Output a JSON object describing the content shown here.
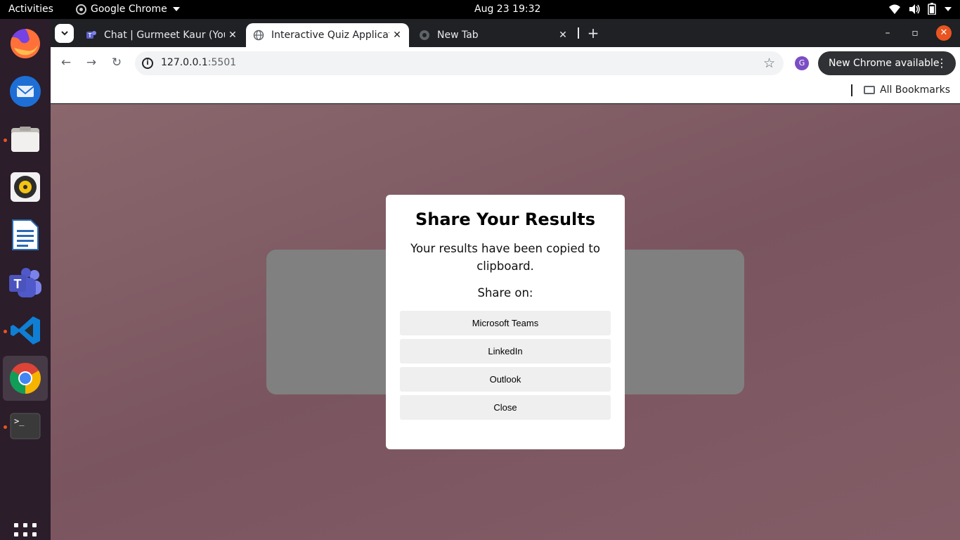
{
  "topbar": {
    "activities": "Activities",
    "app_name": "Google Chrome",
    "clock": "Aug 23  19:32"
  },
  "dock": {
    "items": [
      "firefox-icon",
      "thunderbird-icon",
      "files-icon",
      "rhythmbox-icon",
      "libreoffice-writer-icon",
      "teams-icon",
      "vscode-icon",
      "chrome-icon",
      "terminal-icon"
    ]
  },
  "browser": {
    "tabs": [
      {
        "title": "Chat | Gurmeet Kaur (You",
        "icon": "teams-icon"
      },
      {
        "title": "Interactive Quiz Applicat",
        "icon": "globe-icon",
        "active": true
      },
      {
        "title": "New Tab",
        "icon": "chrome-icon"
      }
    ],
    "url_host": "127.0.0.1",
    "url_port": ":5501",
    "profile_initial": "G",
    "update_label": "New Chrome available",
    "bookmarks_label": "All Bookmarks"
  },
  "modal": {
    "title": "Share Your Results",
    "message": "Your results have been copied to clipboard.",
    "share_on": "Share on:",
    "buttons": {
      "teams": "Microsoft Teams",
      "linkedin": "LinkedIn",
      "outlook": "Outlook",
      "close": "Close"
    }
  },
  "colors": {
    "page_bg": "#7d5a64",
    "card": "#808080",
    "accent": "#e95420"
  }
}
